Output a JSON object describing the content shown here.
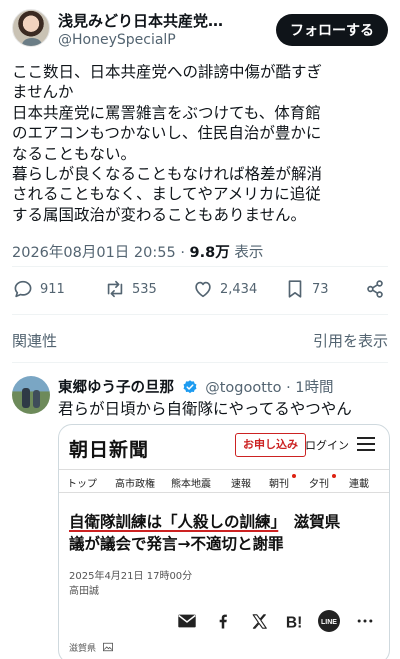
{
  "author": {
    "name": "浅見みどり日本共産党…",
    "handle": "@HoneySpecialP",
    "follow_label": "フォローする"
  },
  "tweet": {
    "text": "ここ数日、日本共産党への誹謗中傷が酷すぎ\nませんか\n日本共産党に罵詈雑言をぶつけても、体育館\nのエアコンもつかないし、住民自治が豊かに\nなることもない。\n暮らしが良くなることもなければ格差が解消\nされることもなく、ましてやアメリカに追従\nする属国政治が変わることもありません。",
    "timestamp": "2026年08月01日 20:55",
    "separator": "·",
    "views": "9.8万",
    "views_label": "表示"
  },
  "actions": {
    "replies": "911",
    "retweets": "535",
    "likes": "2,434",
    "bookmarks": "73"
  },
  "related": {
    "title": "関連性",
    "quote_link": "引用を表示"
  },
  "reply": {
    "name": "東郷ゆう子の旦那",
    "handle": "@togootto",
    "time": "· 1時間",
    "text": "君らが日頃から自衛隊にやってるやつやん"
  },
  "news_card": {
    "logo": "朝日新聞",
    "apply_label": "お申し込み",
    "login_label": "ログイン",
    "nav": [
      "トップ",
      "高市政権",
      "熊本地震",
      "速報",
      "朝刊",
      "夕刊",
      "連載"
    ],
    "headline_line1": "自衛隊訓練は「人殺しの訓練」",
    "headline_line1_tail": "　滋賀県",
    "headline_line2": "議が議会で発言→不適切と謝罪",
    "date": "2025年4月21日 17時00分",
    "author": "高田誠",
    "footer": "滋賀県",
    "share_icons": [
      "mail-icon",
      "facebook-icon",
      "x-icon",
      "hatena-icon",
      "line-icon",
      "more-icon"
    ]
  },
  "colors": {
    "text": "#0f1419",
    "muted": "#536471",
    "verified": "#1d9bf0",
    "news_red": "#cc2222"
  }
}
